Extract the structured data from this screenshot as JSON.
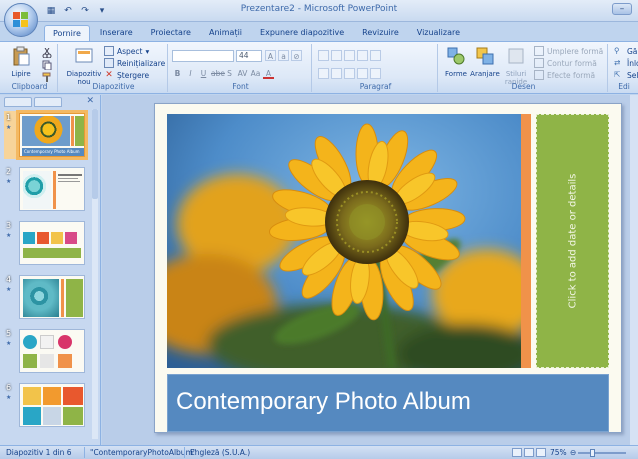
{
  "app": {
    "title": "Prezentare2 - Microsoft PowerPoint"
  },
  "tabs": [
    {
      "label": "Pornire",
      "active": true
    },
    {
      "label": "Inserare"
    },
    {
      "label": "Proiectare"
    },
    {
      "label": "Animații"
    },
    {
      "label": "Expunere diapozitive"
    },
    {
      "label": "Revizuire"
    },
    {
      "label": "Vizualizare"
    }
  ],
  "ribbon": {
    "clipboard": {
      "paste_label": "Lipire",
      "group_label": "Clipboard"
    },
    "slides": {
      "new_slide_label": "Diapozitiv nou",
      "layout_label": "Aspect",
      "reset_label": "Reinițializare",
      "delete_label": "Ștergere",
      "group_label": "Diapozitive"
    },
    "font": {
      "font_name": "",
      "font_size": "44",
      "group_label": "Font"
    },
    "paragraph": {
      "group_label": "Paragraf"
    },
    "drawing": {
      "shapes_label": "Forme",
      "arrange_label": "Aranjare",
      "quick_styles_label": "Stiluri rapide",
      "shape_fill_label": "Umplere formă",
      "shape_outline_label": "Contur formă",
      "shape_effects_label": "Efecte formă",
      "group_label": "Desen"
    },
    "editing": {
      "find_label": "Gă",
      "replace_label": "Înlo",
      "select_label": "Sele",
      "group_label": "Edi"
    }
  },
  "slides_panel": {
    "slides": [
      {
        "number": "1",
        "selected": true
      },
      {
        "number": "2"
      },
      {
        "number": "3"
      },
      {
        "number": "4"
      },
      {
        "number": "5"
      },
      {
        "number": "6"
      }
    ]
  },
  "slide": {
    "title": "Contemporary Photo Album",
    "date_placeholder": "Click to add date or details",
    "colors": {
      "orange": "#f0924a",
      "green": "#8fb447",
      "blue": "#5589c0"
    }
  },
  "thumb_text": {
    "title": "Contemporary Photo Album"
  },
  "status": {
    "slide_position": "Diapozitiv 1 din 6",
    "theme": "\"ContemporaryPhotoAlbum\"",
    "language": "Engleză (S.U.A.)",
    "zoom": "75%"
  },
  "icons": [
    "office-logo-icon",
    "save-icon",
    "undo-icon",
    "redo-icon",
    "paste-icon",
    "cut-icon",
    "copy-icon",
    "format-painter-icon",
    "new-slide-icon",
    "layout-icon",
    "reset-icon",
    "delete-icon",
    "bold-icon",
    "italic-icon",
    "underline-icon",
    "shapes-icon",
    "arrange-icon",
    "quick-styles-icon",
    "find-icon",
    "replace-icon",
    "select-icon"
  ]
}
